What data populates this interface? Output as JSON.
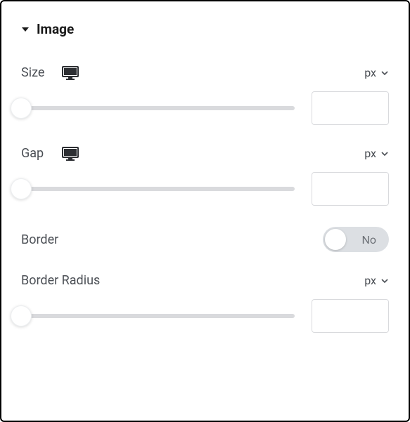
{
  "section": {
    "title": "Image"
  },
  "controls": {
    "size": {
      "label": "Size",
      "unit": "px",
      "value": ""
    },
    "gap": {
      "label": "Gap",
      "unit": "px",
      "value": ""
    },
    "border": {
      "label": "Border",
      "toggle_off_label": "No"
    },
    "border_radius": {
      "label": "Border Radius",
      "unit": "px",
      "value": ""
    }
  }
}
